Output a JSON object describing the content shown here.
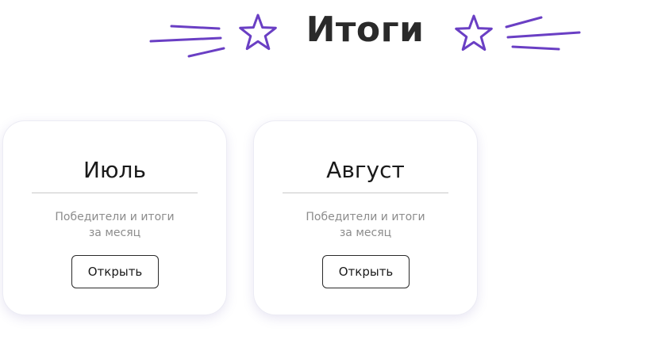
{
  "page": {
    "title": "Итоги"
  },
  "colors": {
    "accent": "#6a3fc4",
    "title": "#2a2a2a",
    "description": "#8c8c8c",
    "divider": "#c9c9c9"
  },
  "decorations": {
    "left_lines_icon": "speed-lines-icon",
    "left_star_icon": "star-icon",
    "right_star_icon": "star-icon",
    "right_lines_icon": "speed-lines-icon"
  },
  "cards": [
    {
      "title": "Июль",
      "description_line1": "Победители и итоги",
      "description_line2": "за месяц",
      "button_label": "Открыть"
    },
    {
      "title": "Август",
      "description_line1": "Победители и итоги",
      "description_line2": "за месяц",
      "button_label": "Открыть"
    }
  ]
}
